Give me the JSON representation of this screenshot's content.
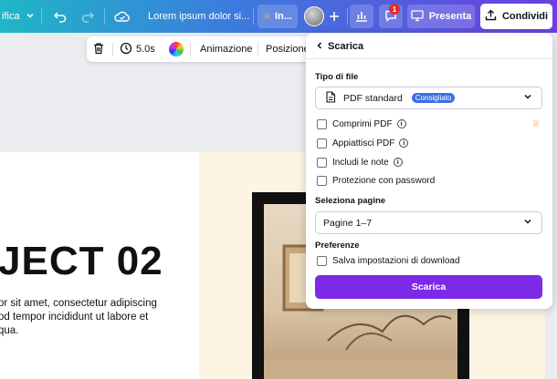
{
  "topbar": {
    "menu_partial": "ifica",
    "design_title": "Lorem ipsum dolor si...",
    "pro_label": "In...",
    "notifications_count": "1",
    "present_label": "Presenta",
    "share_label": "Condividi"
  },
  "floatbar": {
    "duration": "5.0s",
    "animation_label": "Animazione",
    "position_label": "Posizione"
  },
  "canvas": {
    "headline": "JECT 02",
    "paragraph": "or sit amet, consectetur adipiscing od tempor incididunt ut labore et qua."
  },
  "panel": {
    "title": "Scarica",
    "file_type_label": "Tipo di file",
    "file_type_value": "PDF standard",
    "recommended_badge": "Consigliato",
    "options": [
      {
        "label": "Comprimi PDF",
        "info": true,
        "pro": true
      },
      {
        "label": "Appiattisci PDF",
        "info": true,
        "pro": false
      },
      {
        "label": "Includi le note",
        "info": true,
        "pro": false
      },
      {
        "label": "Protezione con password",
        "info": false,
        "pro": false
      }
    ],
    "pages_label": "Seleziona pagine",
    "pages_value": "Pagine 1–7",
    "preferences_label": "Preferenze",
    "save_settings_label": "Salva impostazioni di download",
    "download_button": "Scarica"
  },
  "colors": {
    "accent": "#7d2ae8",
    "badge": "#3c6fe2",
    "notification": "#e52a2a"
  }
}
